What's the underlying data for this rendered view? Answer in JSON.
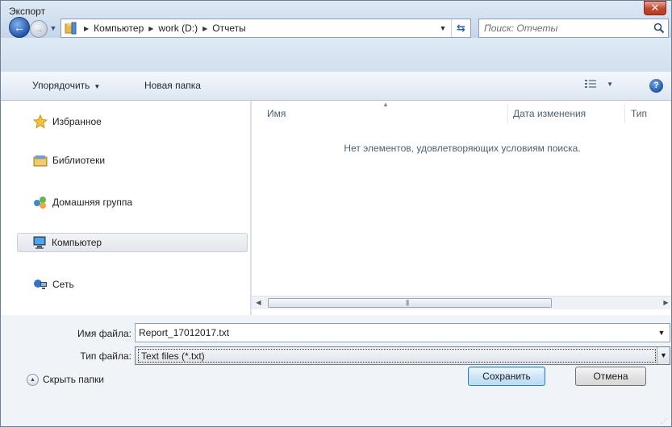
{
  "window": {
    "title": "Экспорт"
  },
  "address": {
    "crumbs": [
      "Компьютер",
      "work (D:)",
      "Отчеты"
    ],
    "search_placeholder": "Поиск: Отчеты"
  },
  "toolbar": {
    "organize_label": "Упорядочить",
    "new_folder_label": "Новая папка"
  },
  "nav": {
    "items": [
      {
        "label": "Избранное",
        "icon": "star-icon"
      },
      {
        "label": "Библиотеки",
        "icon": "libraries-icon"
      },
      {
        "label": "Домашняя группа",
        "icon": "homegroup-icon"
      },
      {
        "label": "Компьютер",
        "icon": "computer-icon",
        "selected": true
      },
      {
        "label": "Сеть",
        "icon": "network-icon"
      }
    ]
  },
  "filelist": {
    "columns": [
      "Имя",
      "Дата изменения",
      "Тип"
    ],
    "empty_message": "Нет элементов, удовлетворяющих условиям поиска."
  },
  "form": {
    "filename_label": "Имя файла:",
    "filename_value": "Report_17012017.txt",
    "filetype_label": "Тип файла:",
    "filetype_value": "Text files (*.txt)",
    "hide_folders_label": "Скрыть папки",
    "save_label": "Сохранить",
    "cancel_label": "Отмена"
  },
  "colors": {
    "window_frame": "#dfe6ef",
    "close_button": "#c6452d",
    "selection": "#e1e6ec",
    "default_button_border": "#2f7fb8"
  }
}
